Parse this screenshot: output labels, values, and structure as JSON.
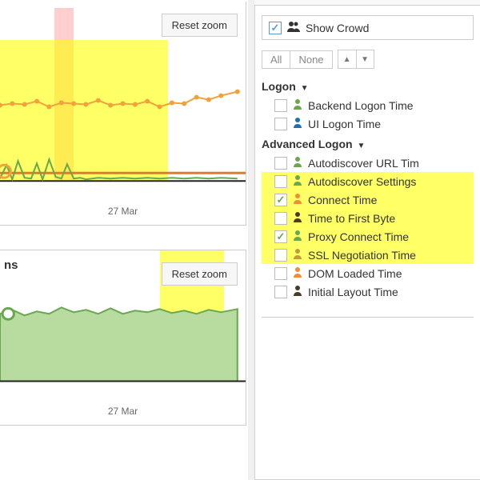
{
  "charts": {
    "reset_label": "Reset zoom",
    "chart1": {
      "x_tick": "27 Mar"
    },
    "chart2": {
      "title_suffix": "ns",
      "x_tick": "27 Mar"
    }
  },
  "sidebar": {
    "show_crowd_label": "Show Crowd",
    "all_label": "All",
    "none_label": "None",
    "groups": [
      {
        "name": "Logon",
        "items": [
          {
            "label": "Backend Logon Time",
            "checked": false,
            "color": "#6aa84f",
            "hl": false
          },
          {
            "label": "UI Logon Time",
            "checked": false,
            "color": "#1f6fb2",
            "hl": false
          }
        ]
      },
      {
        "name": "Advanced Logon",
        "items": [
          {
            "label": "Autodiscover URL Tim",
            "checked": false,
            "color": "#6aa84f",
            "hl": false
          },
          {
            "label": "Autodiscover Settings",
            "checked": false,
            "color": "#6aa84f",
            "hl": true
          },
          {
            "label": "Connect Time",
            "checked": true,
            "color": "#f28c3b",
            "hl": true
          },
          {
            "label": "Time to First Byte",
            "checked": false,
            "color": "#4a3a2a",
            "hl": true
          },
          {
            "label": "Proxy Connect Time",
            "checked": true,
            "color": "#6aa84f",
            "hl": true
          },
          {
            "label": "SSL Negotiation Time",
            "checked": false,
            "color": "#c49a3a",
            "hl": true
          },
          {
            "label": "DOM Loaded Time",
            "checked": false,
            "color": "#f28c3b",
            "hl": false
          },
          {
            "label": "Initial Layout Time",
            "checked": false,
            "color": "#4a3a2a",
            "hl": false
          }
        ]
      }
    ]
  },
  "chart_data": [
    {
      "type": "line",
      "title": "",
      "x": [
        0,
        1,
        2,
        3,
        4,
        5,
        6,
        7,
        8,
        9,
        10,
        11,
        12,
        13,
        14,
        15,
        16,
        17,
        18,
        19
      ],
      "series": [
        {
          "name": "orange-line",
          "color": "#f2a23b",
          "values": [
            48,
            50,
            49,
            52,
            47,
            51,
            50,
            49,
            53,
            48,
            50,
            49,
            52,
            47,
            51,
            50,
            55,
            53,
            57,
            60
          ]
        },
        {
          "name": "orange-baseline",
          "color": "#e07b2e",
          "values": [
            15,
            15,
            15,
            15,
            15,
            15,
            15,
            15,
            15,
            15,
            15,
            15,
            15,
            15,
            15,
            15,
            15,
            15,
            15,
            15
          ]
        },
        {
          "name": "green-spikes",
          "color": "#6aa84f",
          "values": [
            5,
            18,
            3,
            22,
            6,
            4,
            20,
            3,
            25,
            7,
            5,
            19,
            4,
            6,
            3,
            5,
            4,
            6,
            3,
            5
          ]
        }
      ],
      "x_tick_label": "27 Mar",
      "ylim": [
        0,
        100
      ]
    },
    {
      "type": "area",
      "title": "ns",
      "x": [
        0,
        1,
        2,
        3,
        4,
        5,
        6,
        7,
        8,
        9,
        10,
        11,
        12,
        13,
        14,
        15,
        16,
        17,
        18,
        19
      ],
      "series": [
        {
          "name": "green-area",
          "color": "#a8d08d",
          "values": [
            55,
            60,
            52,
            58,
            54,
            62,
            56,
            59,
            55,
            61,
            54,
            58,
            56,
            60,
            55,
            58,
            54,
            59,
            56,
            60
          ]
        }
      ],
      "x_tick_label": "27 Mar",
      "ylim": [
        0,
        100
      ]
    }
  ]
}
